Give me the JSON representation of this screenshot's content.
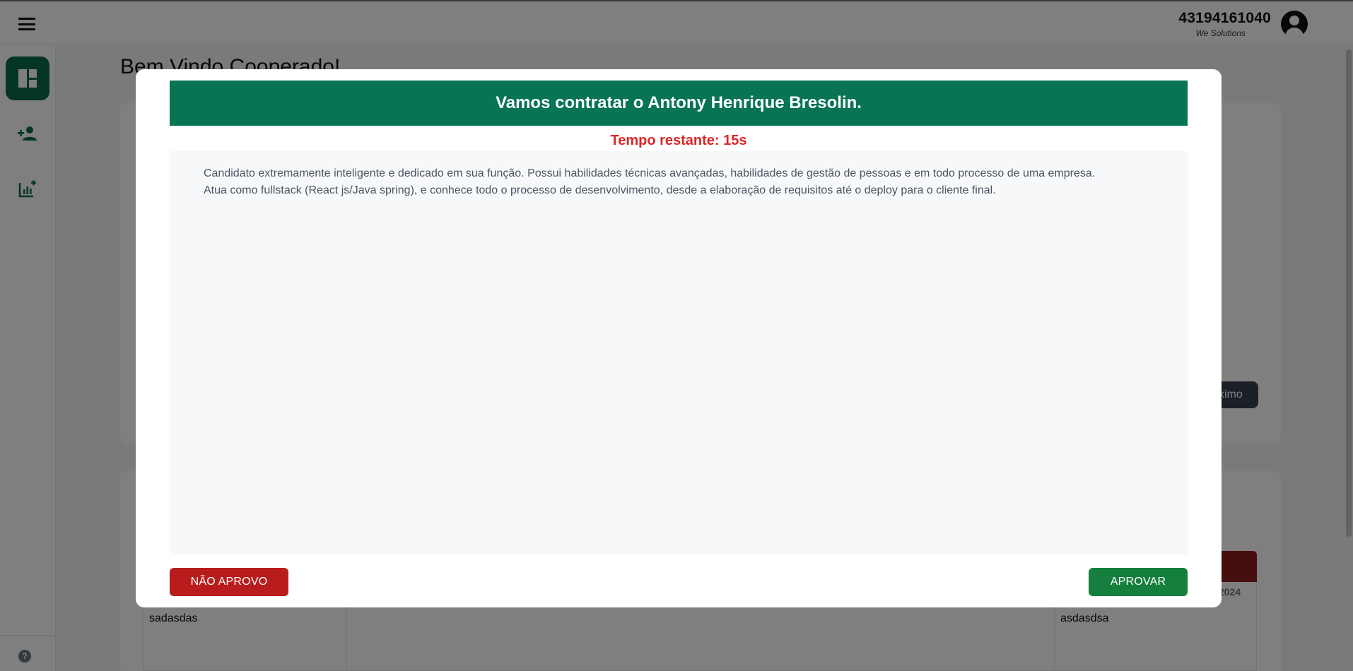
{
  "topbar": {
    "user_id": "43194161040",
    "company": "We Solutions"
  },
  "sidebar": {
    "items": [
      {
        "icon": "dashboard-icon",
        "active": true
      },
      {
        "icon": "add-user-icon",
        "active": false
      },
      {
        "icon": "add-chart-icon",
        "active": false
      }
    ],
    "help_icon": "?"
  },
  "page": {
    "title": "Bem Vindo Cooperado!",
    "next_button_fragment": "ximo",
    "table_cells": [
      "sadasdas",
      "asdasdsa"
    ],
    "date_fragment": "/2024"
  },
  "modal": {
    "title": "Vamos contratar o Antony Henrique Bresolin.",
    "timer": "Tempo restante: 15s",
    "description_line1": "Candidato extremamente inteligente e dedicado em sua função. Possui habilidades técnicas avançadas, habilidades de gestão de pessoas e em todo processo de uma empresa.",
    "description_line2": "Atua como fullstack (React js/Java spring), e conhece todo o processo de desenvolvimento, desde a elaboração de requisitos até o deploy para o cliente final.",
    "reject_label": "NÃO APROVO",
    "approve_label": "APROVAR"
  },
  "colors": {
    "brand_green": "#087454",
    "sidebar_active": "#0b6b4d",
    "timer_red": "#dc2626",
    "reject_red": "#b91c1c",
    "approve_green": "#15803d"
  }
}
